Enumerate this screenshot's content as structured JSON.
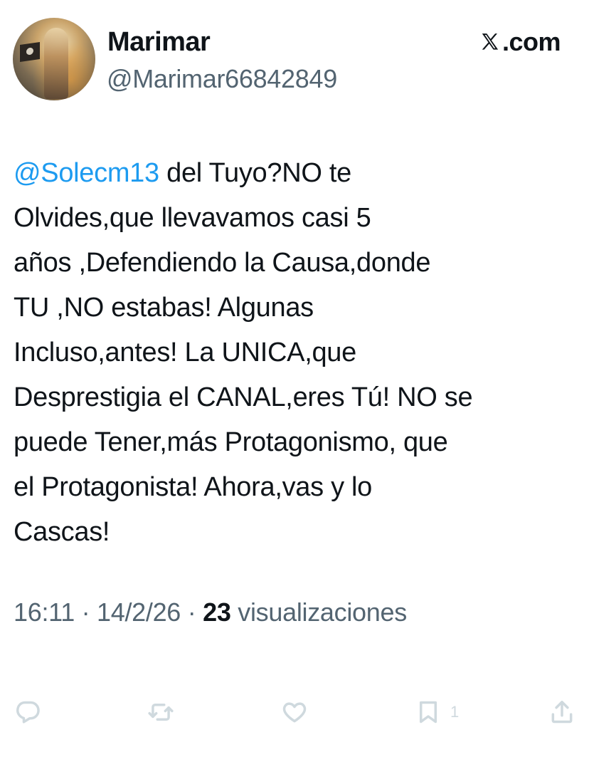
{
  "author": {
    "name": "Marimar",
    "handle": "@Marimar66842849"
  },
  "brand": {
    "label": ".com"
  },
  "tweet": {
    "mention": "@Solecm13",
    "text": " del Tuyo?NO te\nOlvides,que llevavamos casi 5\naños ,Defendiendo la Causa,donde\nTU ,NO estabas! Algunas\nIncluso,antes! La UNICA,que\nDesprestigia el CANAL,eres Tú! NO se\npuede Tener,más Protagonismo, que\nel Protagonista! Ahora,vas y lo\nCascas!"
  },
  "meta": {
    "time": "16:11",
    "separator": " · ",
    "date": "14/2/26",
    "views_count": "23",
    "views_label": " visualizaciones"
  },
  "actions": {
    "bookmark_count": "1"
  },
  "colors": {
    "link": "#1d9bf0",
    "secondary_text": "#536471",
    "icon": "#cfd9de"
  },
  "icons": [
    "x-logo-icon",
    "reply-icon",
    "retweet-icon",
    "like-icon",
    "bookmark-icon",
    "share-icon"
  ]
}
